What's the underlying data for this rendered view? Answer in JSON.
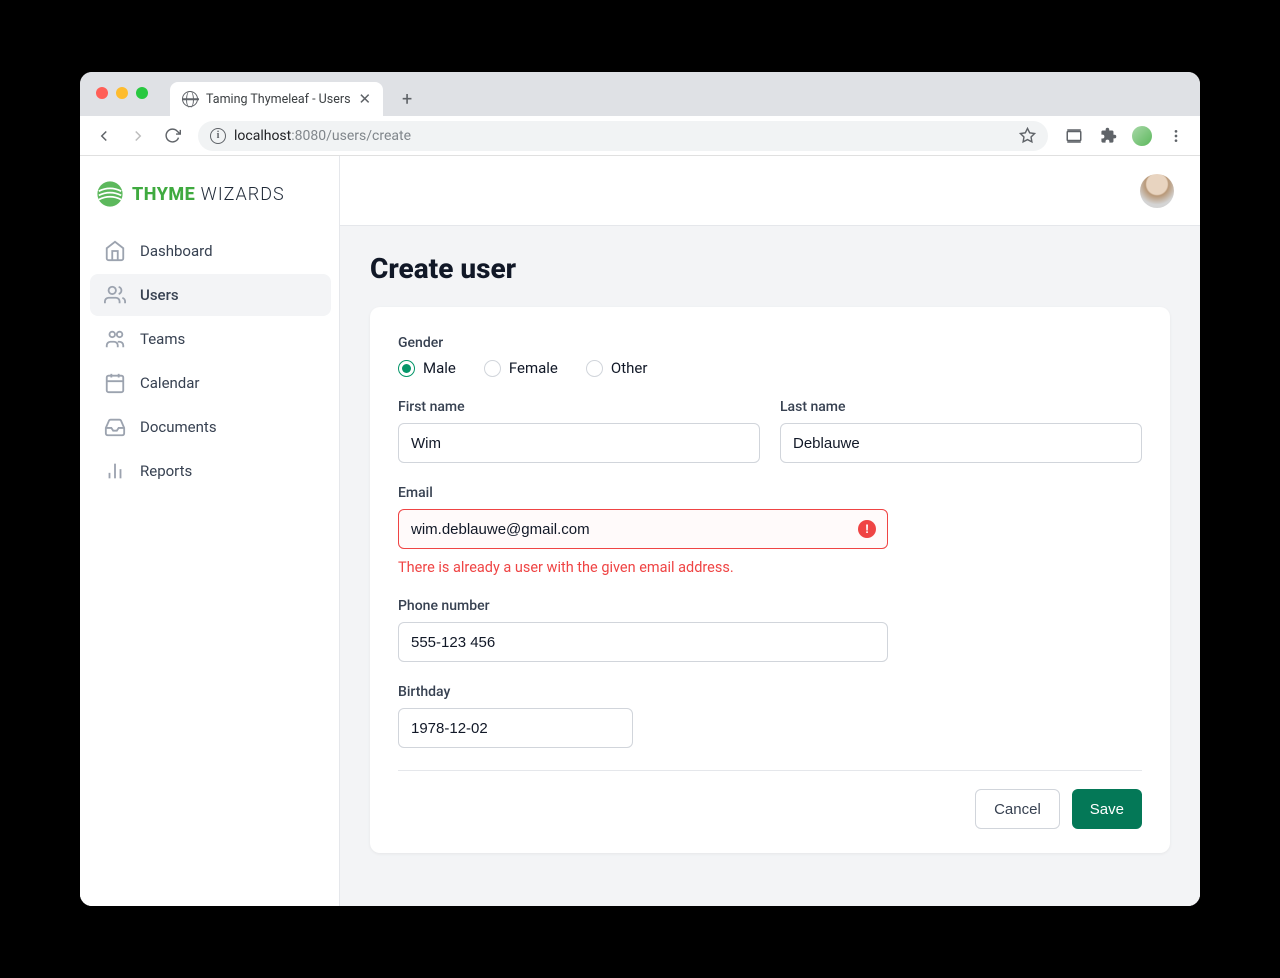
{
  "browser": {
    "tab_title": "Taming Thymeleaf - Users",
    "url_host": "localhost",
    "url_port": ":8080",
    "url_path": "/users/create"
  },
  "logo": {
    "bold": "THYME",
    "light": " WIZARDS"
  },
  "sidebar": {
    "items": [
      {
        "label": "Dashboard"
      },
      {
        "label": "Users"
      },
      {
        "label": "Teams"
      },
      {
        "label": "Calendar"
      },
      {
        "label": "Documents"
      },
      {
        "label": "Reports"
      }
    ]
  },
  "page": {
    "title": "Create user"
  },
  "form": {
    "gender": {
      "label": "Gender",
      "options": [
        {
          "label": "Male",
          "checked": true
        },
        {
          "label": "Female",
          "checked": false
        },
        {
          "label": "Other",
          "checked": false
        }
      ]
    },
    "first_name": {
      "label": "First name",
      "value": "Wim"
    },
    "last_name": {
      "label": "Last name",
      "value": "Deblauwe"
    },
    "email": {
      "label": "Email",
      "value": "wim.deblauwe@gmail.com",
      "error": "There is already a user with the given email address."
    },
    "phone": {
      "label": "Phone number",
      "value": "555-123 456"
    },
    "birthday": {
      "label": "Birthday",
      "value": "1978-12-02"
    },
    "cancel_label": "Cancel",
    "save_label": "Save"
  }
}
